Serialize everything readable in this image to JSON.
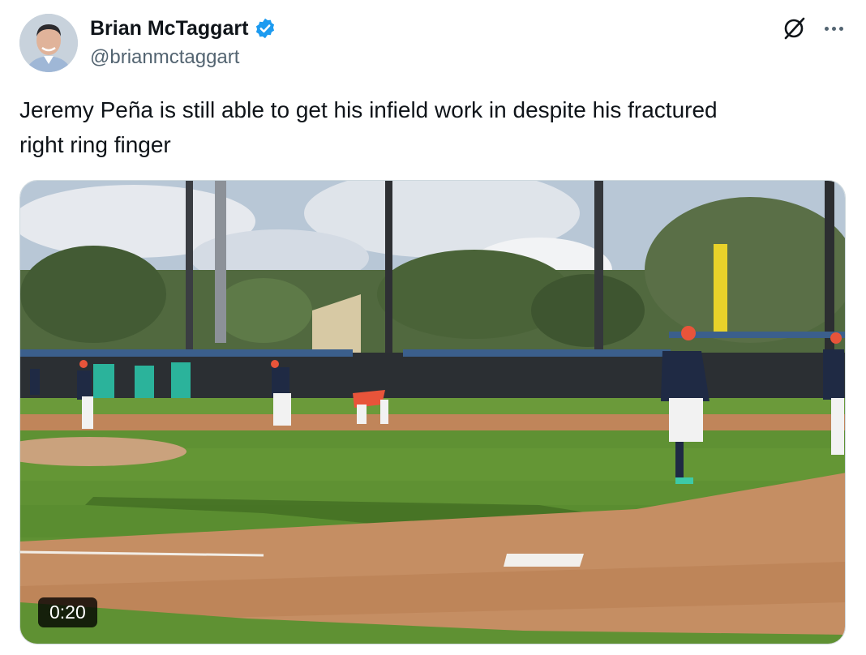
{
  "author": {
    "display_name": "Brian McTaggart",
    "handle": "@brianmctaggart",
    "verified": true,
    "verified_color": "#1d9bf0"
  },
  "actions": {
    "grok_icon": "grok-icon",
    "more_icon": "more-dots-icon"
  },
  "tweet": {
    "text": "Jeremy Peña is still able to get his infield work in despite his fractured\nright ring finger"
  },
  "video": {
    "duration": "0:20"
  }
}
